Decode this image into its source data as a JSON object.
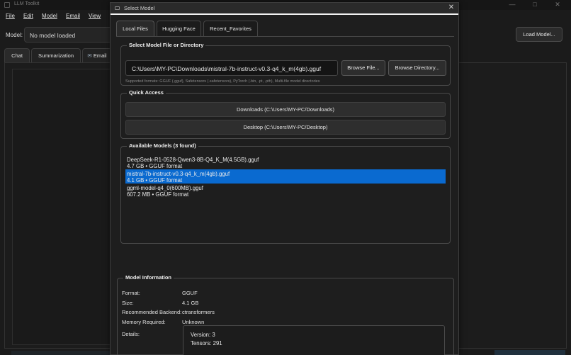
{
  "main": {
    "title": "LLM Toolkit",
    "menu": [
      "File",
      "Edit",
      "Model",
      "Email",
      "View"
    ],
    "model_label": "Model:",
    "model_select": "No model loaded",
    "load_button": "Load Model...",
    "tabs": [
      "Chat",
      "Summarization",
      "Email"
    ]
  },
  "dialog": {
    "title": "Select Model",
    "tabs": [
      "Local Files",
      "Hugging Face",
      "Recent_Favorites"
    ],
    "select_group": {
      "title": "Select Model File or Directory",
      "path_value": "C:\\Users\\MY-PC\\Downloads\\mistral-7b-instruct-v0.3-q4_k_m(4gb).gguf",
      "browse_file": "Browse File...",
      "browse_directory": "Browse Directory...",
      "hint": "Supported formats: GGUF (.gguf), Safetensors (.safetensors), PyTorch (.bin, .pt, .pth), Multi-file model directories"
    },
    "quick_access": {
      "title": "Quick Access",
      "buttons": [
        "Downloads (C:\\Users\\MY-PC/Downloads)",
        "Desktop (C:\\Users\\MY-PC/Desktop)"
      ]
    },
    "available_models": {
      "title": "Available Models (3 found)",
      "items": [
        {
          "name": "DeepSeek-R1-0528-Qwen3-8B-Q4_K_M(4.5GB).gguf",
          "meta": "4.7 GB • GGUF format",
          "selected": false
        },
        {
          "name": "mistral-7b-instruct-v0.3-q4_k_m(4gb).gguf",
          "meta": "4.1 GB • GGUF format",
          "selected": true
        },
        {
          "name": "ggml-model-q4_0(600MB).gguf",
          "meta": "607.2 MB • GGUF format",
          "selected": false
        }
      ]
    },
    "model_info": {
      "title": "Model Information",
      "format_label": "Format:",
      "format_value": "GGUF",
      "size_label": "Size:",
      "size_value": "4.1 GB",
      "backend_label": "Recommended Backend:",
      "backend_value": "ctransformers",
      "memory_label": "Memory Required:",
      "memory_value": "Unknown",
      "details_label": "Details:",
      "details_lines": [
        "Version: 3",
        "Tensors: 291"
      ]
    }
  },
  "colors": {
    "selection": "#0a6ad0",
    "background": "#1e1e1e"
  }
}
